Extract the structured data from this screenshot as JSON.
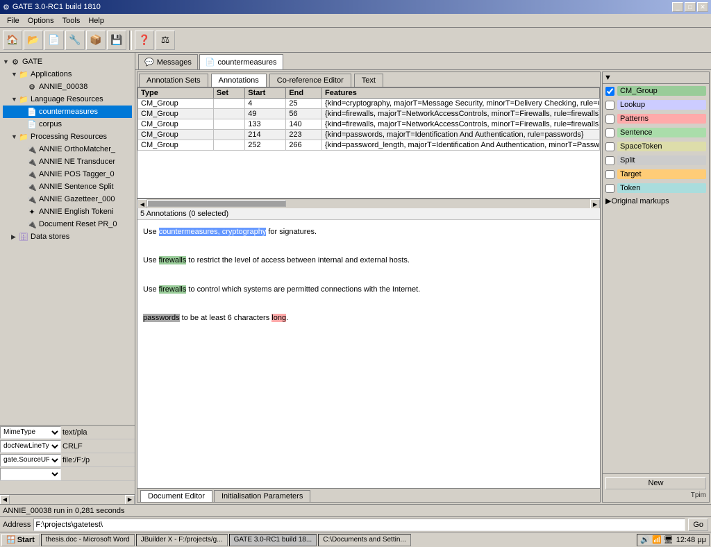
{
  "window": {
    "title": "GATE 3.0-RC1 build 1810",
    "title_icon": "⚙"
  },
  "menu": {
    "items": [
      "File",
      "Options",
      "Tools",
      "Help"
    ]
  },
  "toolbar": {
    "buttons": [
      {
        "icon": "🏠",
        "name": "home"
      },
      {
        "icon": "📂",
        "name": "open"
      },
      {
        "icon": "📄",
        "name": "doc"
      },
      {
        "icon": "🔧",
        "name": "tools"
      },
      {
        "icon": "📦",
        "name": "package"
      },
      {
        "icon": "💾",
        "name": "save"
      },
      {
        "icon": "❓",
        "name": "help"
      },
      {
        "icon": "⚖",
        "name": "balance"
      }
    ]
  },
  "left_panel": {
    "root_label": "GATE",
    "tree": [
      {
        "label": "Applications",
        "icon": "folder",
        "expanded": true,
        "children": [
          {
            "label": "ANNIE_00038",
            "icon": "gear",
            "expanded": true,
            "children": []
          }
        ]
      },
      {
        "label": "Language Resources",
        "icon": "folder",
        "expanded": true,
        "children": [
          {
            "label": "countermeasures",
            "icon": "doc",
            "selected": true,
            "children": []
          },
          {
            "label": "corpus",
            "icon": "doc",
            "children": []
          }
        ]
      },
      {
        "label": "Processing Resources",
        "icon": "folder",
        "expanded": true,
        "children": [
          {
            "label": "ANNIE OrthoMatcher_",
            "icon": "plug"
          },
          {
            "label": "ANNIE NE Transducer",
            "icon": "plug"
          },
          {
            "label": "ANNIE POS Tagger_0",
            "icon": "plug"
          },
          {
            "label": "ANNIE Sentence Split",
            "icon": "plug"
          },
          {
            "label": "ANNIE Gazetteer_000",
            "icon": "plug"
          },
          {
            "label": "ANNIE English Tokeni",
            "icon": "star"
          },
          {
            "label": "Document Reset PR_0",
            "icon": "plug"
          }
        ]
      },
      {
        "label": "Data stores",
        "icon": "folder",
        "expanded": false,
        "children": []
      }
    ],
    "props": [
      {
        "key": "MimeType",
        "val": "text/pla"
      },
      {
        "key": "docNewLineType",
        "val": "CRLF"
      },
      {
        "key": "gate.SourceURL",
        "val": "file:/F:/p"
      }
    ]
  },
  "doc_tabs": [
    {
      "label": "Messages",
      "active": false,
      "icon": "💬"
    },
    {
      "label": "countermeasures",
      "active": true,
      "icon": "📄"
    }
  ],
  "sub_tabs": [
    {
      "label": "Annotation Sets",
      "active": false
    },
    {
      "label": "Annotations",
      "active": true
    },
    {
      "label": "Co-reference Editor",
      "active": false
    },
    {
      "label": "Text",
      "active": false
    }
  ],
  "ann_table": {
    "columns": [
      "Type",
      "Set",
      "Start",
      "End",
      "Features"
    ],
    "rows": [
      {
        "type": "CM_Group",
        "set": "",
        "start": "4",
        "end": "25",
        "features": "{kind=cryptography, majorT=Message Security, minorT=Delivery Checking, rule=Cryp"
      },
      {
        "type": "CM_Group",
        "set": "",
        "start": "49",
        "end": "56",
        "features": "{kind=firewalls, majorT=NetworkAccessControls, minorT=Firewalls, rule=firewalls}"
      },
      {
        "type": "CM_Group",
        "set": "",
        "start": "133",
        "end": "140",
        "features": "{kind=firewalls, majorT=NetworkAccessControls, minorT=Firewalls, rule=firewalls}"
      },
      {
        "type": "CM_Group",
        "set": "",
        "start": "214",
        "end": "223",
        "features": "{kind=passwords, majorT=Identification And Authentication, rule=passwords}"
      },
      {
        "type": "CM_Group",
        "set": "",
        "start": "252",
        "end": "266",
        "features": "{kind=password_length, majorT=Identification And Authentication, minorT=Password l"
      }
    ]
  },
  "ann_status": "5 Annotations (0 selected)",
  "text_content": {
    "lines": [
      {
        "prefix": "Use ",
        "highlight": "countermeasures, cryptography",
        "highlight_class": "highlight-blue",
        "suffix": " for signatures."
      },
      {
        "prefix": "Use ",
        "highlight": "firewalls",
        "highlight_class": "highlight-green",
        "suffix": " to restrict the level of access between internal and external hosts."
      },
      {
        "prefix": "Use ",
        "highlight": "firewalls",
        "highlight_class": "highlight-green",
        "suffix": " to control which systems are permitted connections with the Internet."
      },
      {
        "prefix": "",
        "highlight": "passwords",
        "highlight_class": "highlight-gray",
        "suffix": " to be at least 6 characters ",
        "extra": "long",
        "extra_class": "highlight-pink",
        "end": "."
      }
    ]
  },
  "right_panel": {
    "annotation_types": [
      {
        "label": "CM_Group",
        "checked": true,
        "color": "ann-color-cm"
      },
      {
        "label": "Lookup",
        "checked": false,
        "color": "ann-color-lookup"
      },
      {
        "label": "Patterns",
        "checked": false,
        "color": "ann-color-patterns"
      },
      {
        "label": "Sentence",
        "checked": false,
        "color": "ann-color-sentence"
      },
      {
        "label": "SpaceToken",
        "checked": false,
        "color": "ann-color-spacetoken"
      },
      {
        "label": "Split",
        "checked": false,
        "color": "ann-color-split"
      },
      {
        "label": "Target",
        "checked": false,
        "color": "ann-color-target"
      },
      {
        "label": "Token",
        "checked": false,
        "color": "ann-color-token"
      }
    ],
    "section": "Original markups",
    "new_btn": "New",
    "tpim": "Tpim"
  },
  "bottom_tabs": [
    {
      "label": "Document Editor",
      "active": true
    },
    {
      "label": "Initialisation Parameters",
      "active": false
    }
  ],
  "statusbar": {
    "text": "ANNIE_00038 run in 0,281 seconds"
  },
  "address_bar": {
    "label": "Address",
    "value": "F:\\projects\\gatetest\\"
  },
  "taskbar": {
    "start_label": "Start",
    "items": [
      {
        "label": "thesis.doc - Microsoft Word",
        "active": false
      },
      {
        "label": "JBuilder X - F:/projects/g...",
        "active": false
      },
      {
        "label": "GATE 3.0-RC1 build 18...",
        "active": true
      },
      {
        "label": "C:\\Documents and Settin...",
        "active": false
      }
    ],
    "time": "12:48 μμ"
  }
}
